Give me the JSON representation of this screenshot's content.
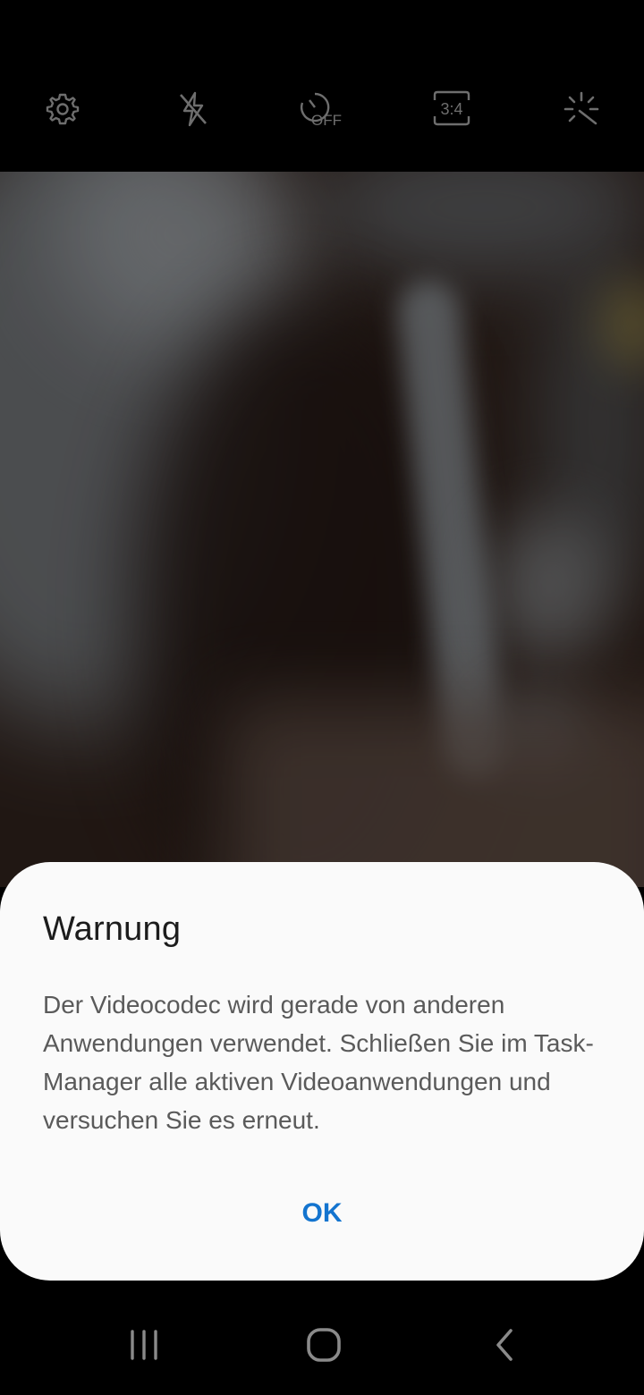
{
  "camera_toolbar": {
    "icons": [
      "gear-icon",
      "flash-off-icon",
      "timer-off-icon",
      "aspect-ratio-icon",
      "filter-effects-icon"
    ],
    "timer_label": "OFF",
    "ratio_label": "3:4"
  },
  "dialog": {
    "title": "Warnung",
    "message": "Der Videocodec wird gerade von anderen Anwendungen verwendet. Schließen Sie im Task-Manager alle aktiven Videoanwendungen und versuchen Sie es erneut.",
    "ok_label": "OK"
  },
  "navigation": {
    "icons": [
      "recent-apps-icon",
      "home-icon",
      "back-icon"
    ]
  },
  "colors": {
    "accent": "#1374cf",
    "dialog_background": "#fafafa",
    "title_text": "#1c1c1c",
    "message_text": "#5a5a5a",
    "toolbar_icon": "#6e6e6e"
  }
}
